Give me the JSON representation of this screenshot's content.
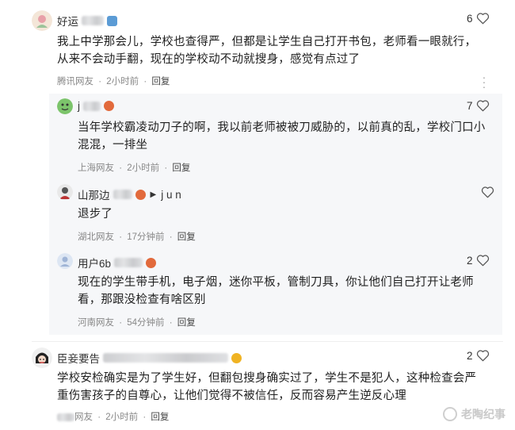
{
  "comments": [
    {
      "name": "好运",
      "text": "我上中学那会儿，学校也查得严，但都是让学生自己打开书包，老师看一眼就行，从来不会动手翻，现在的学校动不动就搜身，感觉有点过了",
      "source": "腾讯网友",
      "time": "2小时前",
      "reply_label": "回复",
      "likes": "6"
    }
  ],
  "replies": [
    {
      "name": "j",
      "text": "当年学校霸凌动刀子的啊，我以前老师被被刀威胁的，以前真的乱，学校门口小混混，一排坐",
      "source": "上海网友",
      "time": "2小时前",
      "reply_label": "回复",
      "likes": "7"
    },
    {
      "name": "山那边",
      "reply_to": "j u n",
      "text": "退步了",
      "source": "湖北网友",
      "time": "17分钟前",
      "reply_label": "回复",
      "likes": ""
    },
    {
      "name": "用户6b",
      "text": "现在的学生带手机，电子烟，迷你平板，管制刀具，你让他们自己打开让老师看，那跟没检查有啥区别",
      "source": "河南网友",
      "time": "54分钟前",
      "reply_label": "回复",
      "likes": "2"
    }
  ],
  "comment2": {
    "name": "臣妾要告",
    "text": "学校安检确实是为了学生好，但翻包搜身确实过了，学生不是犯人，这种检查会严重伤害孩子的自尊心，让他们觉得不被信任，反而容易产生逆反心理",
    "source": "网友",
    "time": "2小时前",
    "reply_label": "回复",
    "likes": "2"
  },
  "watermark": "老陶纪事",
  "meta_sep": "·",
  "colors": {
    "reply_bg": "#f6f7f9",
    "badge_blue": "#5b9bd5",
    "badge_orange": "#e26a3c"
  },
  "icons": {
    "like": "heart-outline-icon",
    "more": "vertical-dots-icon"
  }
}
